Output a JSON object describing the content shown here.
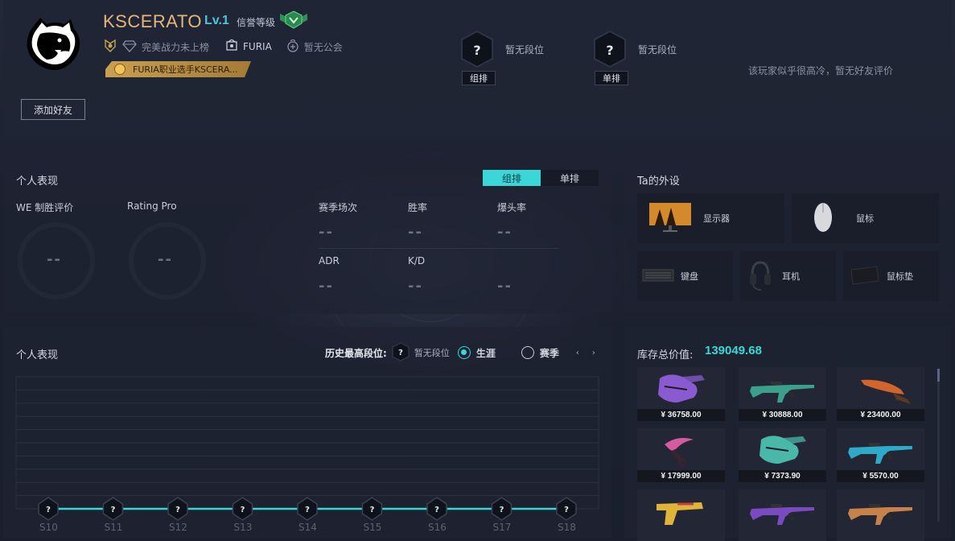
{
  "header": {
    "player_name": "KSCERATO",
    "level": "Lv.1",
    "credit_label": "信誉等级",
    "power_rank": "完美战力未上榜",
    "team": "FURIA",
    "guild": "暂无公会",
    "pro_badge": "FURIA职业选手KSCERA...",
    "add_friend": "添加好友",
    "rank_group": {
      "tag": "组排",
      "status": "暂无段位",
      "symbol": "?"
    },
    "rank_solo": {
      "tag": "单排",
      "status": "暂无段位",
      "symbol": "?"
    },
    "friend_eval": "该玩家似乎很高冷，暂无好友评价"
  },
  "performance": {
    "title": "个人表现",
    "toggle_group": "组排",
    "toggle_solo": "单排",
    "we_label": "WE 制胜评价",
    "we_value": "--",
    "rating_label": "Rating Pro",
    "rating_value": "--",
    "stats": [
      {
        "label": "赛季场次",
        "value": "--"
      },
      {
        "label": "胜率",
        "value": "--"
      },
      {
        "label": "爆头率",
        "value": "--"
      },
      {
        "label": "ADR",
        "value": "--"
      },
      {
        "label": "K/D",
        "value": "--"
      },
      {
        "label": "",
        "value": "--"
      }
    ]
  },
  "gear": {
    "title": "Ta的外设",
    "items": [
      {
        "label": "显示器",
        "icon": "monitor-icon"
      },
      {
        "label": "鼠标",
        "icon": "mouse-icon"
      },
      {
        "label": "键盘",
        "icon": "keyboard-icon"
      },
      {
        "label": "耳机",
        "icon": "headset-icon"
      },
      {
        "label": "鼠标垫",
        "icon": "mousepad-icon"
      }
    ]
  },
  "history": {
    "title": "个人表现",
    "highest_label": "历史最高段位:",
    "highest_value": "暂无段位",
    "opt_career": "生涯",
    "opt_season": "赛季",
    "selected": "生涯",
    "prev": "‹",
    "next": "›",
    "seasons": [
      {
        "label": "S10",
        "symbol": "?"
      },
      {
        "label": "S11",
        "symbol": "?"
      },
      {
        "label": "S12",
        "symbol": "?"
      },
      {
        "label": "S13",
        "symbol": "?"
      },
      {
        "label": "S14",
        "symbol": "?"
      },
      {
        "label": "S15",
        "symbol": "?"
      },
      {
        "label": "S16",
        "symbol": "?"
      },
      {
        "label": "S17",
        "symbol": "?"
      },
      {
        "label": "S18",
        "symbol": "?"
      }
    ]
  },
  "inventory": {
    "title": "库存总价值:",
    "total": "139049.68",
    "items": [
      {
        "price": "¥ 36758.00",
        "icon": "gloves-icon",
        "color": "#8a5bd0"
      },
      {
        "price": "¥ 30888.00",
        "icon": "rifle-icon",
        "color": "#3aa08c"
      },
      {
        "price": "¥ 23400.00",
        "icon": "knife-icon",
        "color": "#d2642e"
      },
      {
        "price": "¥ 17999.00",
        "icon": "karambit-icon",
        "color": "#d55aa0"
      },
      {
        "price": "¥ 7373.90",
        "icon": "gloves-icon",
        "color": "#4ab8a8"
      },
      {
        "price": "¥ 5570.00",
        "icon": "rifle-icon",
        "color": "#2fa9c9"
      },
      {
        "price": "",
        "icon": "pistol-icon",
        "color": "#e0b33a"
      },
      {
        "price": "",
        "icon": "rifle-icon",
        "color": "#7a4ac0"
      },
      {
        "price": "",
        "icon": "rifle-icon",
        "color": "#c7824a"
      }
    ]
  },
  "colors": {
    "accent": "#3ad6d8",
    "name_gold": "#e5b57a",
    "level_blue": "#4fc3e0",
    "credit_green": "#3dbb6d"
  }
}
